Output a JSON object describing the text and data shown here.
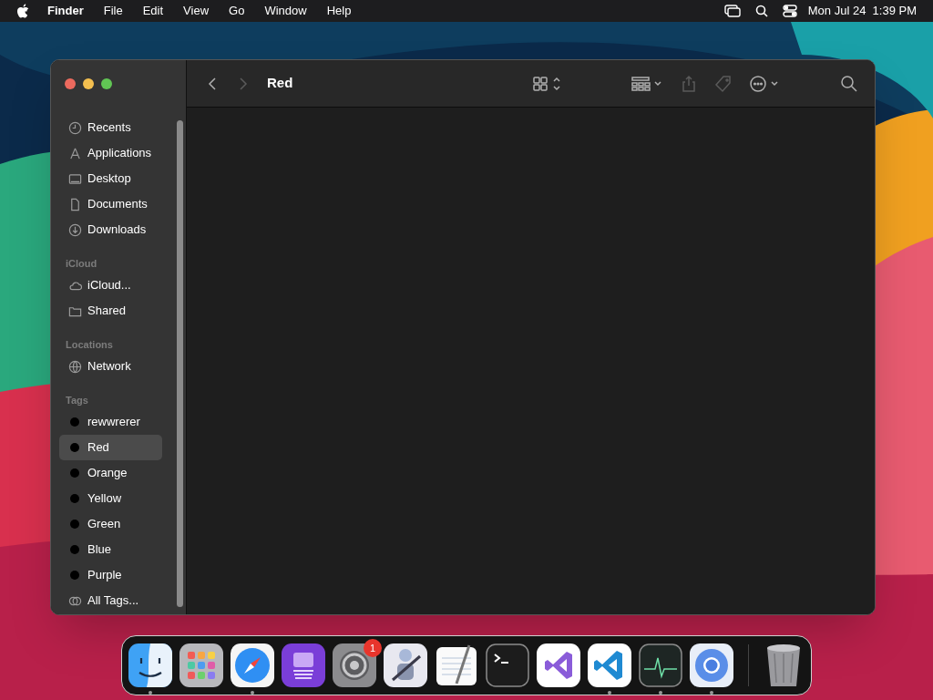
{
  "menu_bar": {
    "app": "Finder",
    "menus": [
      "File",
      "Edit",
      "View",
      "Go",
      "Window",
      "Help"
    ],
    "clock": "Mon Jul 24  1:39 PM"
  },
  "window": {
    "title": "Red",
    "toolbar": {
      "back_disabled": false,
      "forward_disabled": true,
      "share_disabled": true,
      "tags_disabled": true
    },
    "sidebar": {
      "sections": [
        {
          "items": [
            {
              "label": "Recents",
              "kind": "clock",
              "selected": false
            },
            {
              "label": "Applications",
              "kind": "apps",
              "selected": false
            },
            {
              "label": "Desktop",
              "kind": "desktop",
              "selected": false
            },
            {
              "label": "Documents",
              "kind": "document",
              "selected": false
            },
            {
              "label": "Downloads",
              "kind": "download",
              "selected": false
            }
          ]
        },
        {
          "header": "iCloud",
          "items": [
            {
              "label": "iCloud...",
              "kind": "cloud",
              "selected": false
            },
            {
              "label": "Shared",
              "kind": "shared",
              "selected": false
            }
          ]
        },
        {
          "header": "Locations",
          "items": [
            {
              "label": "Network",
              "kind": "globe",
              "selected": false
            }
          ]
        },
        {
          "header": "Tags",
          "items": [
            {
              "label": "rewwrerer",
              "kind": "tag",
              "selected": false
            },
            {
              "label": "Red",
              "kind": "tag",
              "selected": true
            },
            {
              "label": "Orange",
              "kind": "tag",
              "selected": false
            },
            {
              "label": "Yellow",
              "kind": "tag",
              "selected": false
            },
            {
              "label": "Green",
              "kind": "tag",
              "selected": false
            },
            {
              "label": "Blue",
              "kind": "tag",
              "selected": false
            },
            {
              "label": "Purple",
              "kind": "tag",
              "selected": false
            },
            {
              "label": "All Tags...",
              "kind": "alltags",
              "selected": false
            }
          ]
        }
      ]
    }
  },
  "dock": {
    "apps": [
      {
        "kind": "finder",
        "running": true
      },
      {
        "kind": "launchpad",
        "running": false
      },
      {
        "kind": "safari",
        "running": true
      },
      {
        "kind": "configurator",
        "running": false
      },
      {
        "kind": "settings",
        "running": false,
        "badge": "1"
      },
      {
        "kind": "automator",
        "running": false
      },
      {
        "kind": "textedit",
        "running": false
      },
      {
        "kind": "terminal",
        "running": false
      },
      {
        "kind": "vs",
        "running": false
      },
      {
        "kind": "vscode",
        "running": true
      },
      {
        "kind": "activity",
        "running": true
      },
      {
        "kind": "chromium",
        "running": true
      }
    ],
    "trash": {
      "running": false
    }
  }
}
